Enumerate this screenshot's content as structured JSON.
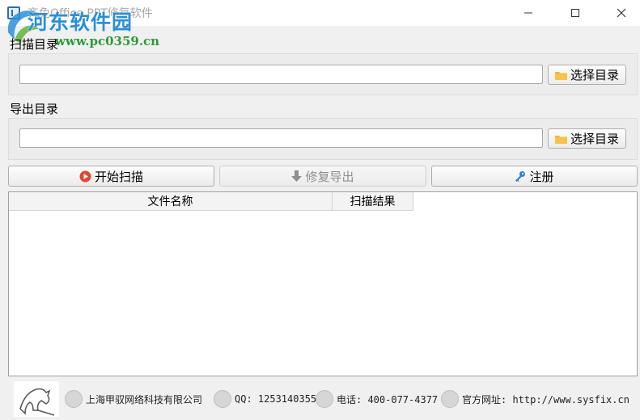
{
  "window": {
    "title": "齐免Office PPT修复软件",
    "min_icon": "minimize-icon",
    "max_icon": "maximize-icon",
    "close_icon": "close-icon"
  },
  "watermark": {
    "site_name": "河东软件园",
    "url": "www.pc0359.cn"
  },
  "scan_section": {
    "label": "扫描目录",
    "path_value": "",
    "browse_label": "选择目录",
    "browse_icon": "folder-icon"
  },
  "export_section": {
    "label": "导出目录",
    "path_value": "",
    "browse_label": "选择目录",
    "browse_icon": "folder-icon"
  },
  "actions": {
    "start_scan": "开始扫描",
    "repair_export": "修复导出",
    "register": "注册"
  },
  "table": {
    "columns": [
      "文件名称",
      "扫描结果"
    ],
    "rows": []
  },
  "footer": {
    "company": "上海甲驭网络科技有限公司",
    "qq": "QQ: 1253140355",
    "phone": "电话: 400-077-4377",
    "website": "官方网址: http://www.sysfix.cn"
  },
  "colors": {
    "watermark_blue": "#2b8fd8",
    "watermark_green": "#2a9a3a",
    "play_red": "#e8452c",
    "key_blue": "#2f7ad6",
    "folder_yellow": "#f3b63a"
  }
}
